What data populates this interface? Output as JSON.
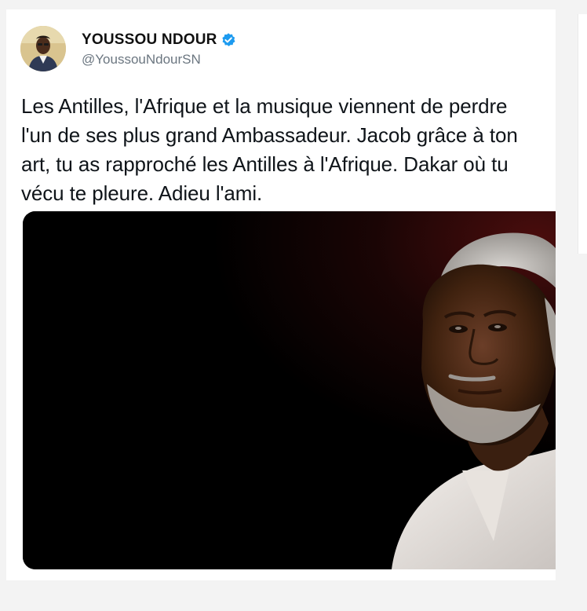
{
  "tweet": {
    "author": {
      "display_name": "YOUSSOU NDOUR",
      "handle": "@YoussouNdourSN",
      "verified": true,
      "avatar_icon": "avatar-portrait"
    },
    "text": "Les Antilles, l'Afrique et la musique viennent de perdre\nl'un de ses plus grand Ambassadeur. Jacob grâce à ton\nart, tu as rapproché les Antilles à l'Afrique. Dakar où tu\nvécu te pleure. Adieu l'ami.",
    "media": {
      "kind": "photo",
      "subject_icon": "portrait-photo"
    }
  },
  "colors": {
    "verified_blue": "#1d9bf0",
    "text": "#0f1419",
    "muted": "#6b7680",
    "media_bg": "#000000"
  }
}
